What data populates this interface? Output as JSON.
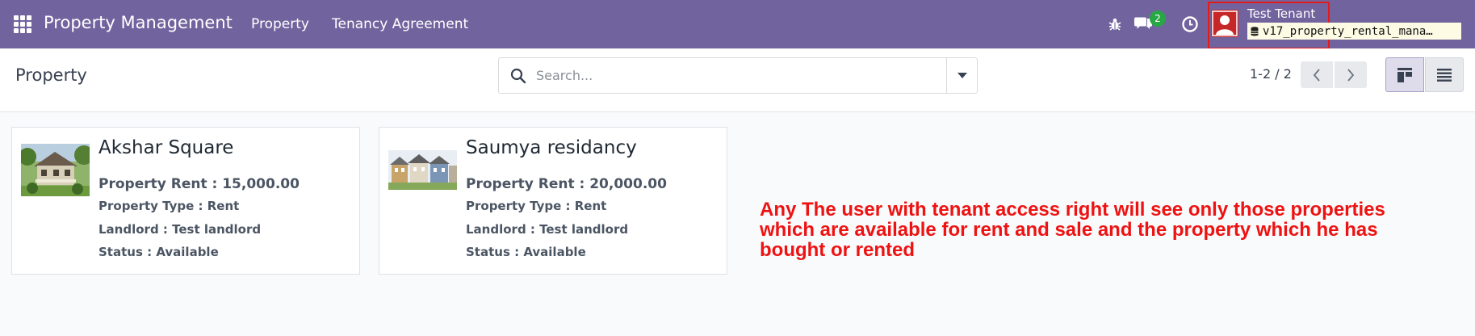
{
  "navbar": {
    "brand": "Property Management",
    "menus": [
      "Property",
      "Tenancy Agreement"
    ],
    "icons": [
      "apps-grid-icon",
      "bug-icon",
      "chat-icon",
      "clock-icon"
    ],
    "messages_badge": "2",
    "user_name": "Test Tenant",
    "database": "v17_property_rental_mana…",
    "background_color": "#71639e"
  },
  "control_panel": {
    "title": "Property",
    "search_placeholder": "Search...",
    "pager": "1-2 / 2",
    "view_icons": [
      "kanban-view-icon",
      "list-view-icon"
    ]
  },
  "cards": [
    {
      "title": "Akshar Square",
      "rent": "Property Rent : 15,000.00",
      "type": "Property Type : Rent",
      "landlord": "Landlord : Test landlord",
      "status": "Status : Available"
    },
    {
      "title": "Saumya residancy",
      "rent": "Property Rent : 20,000.00",
      "type": "Property Type : Rent",
      "landlord": "Landlord : Test landlord",
      "status": "Status : Available"
    }
  ],
  "annotation": {
    "text": "Any The user with tenant access right will see only those properties which are available for rent and sale and the property which he has bought or rented",
    "color": "#ee1212"
  }
}
